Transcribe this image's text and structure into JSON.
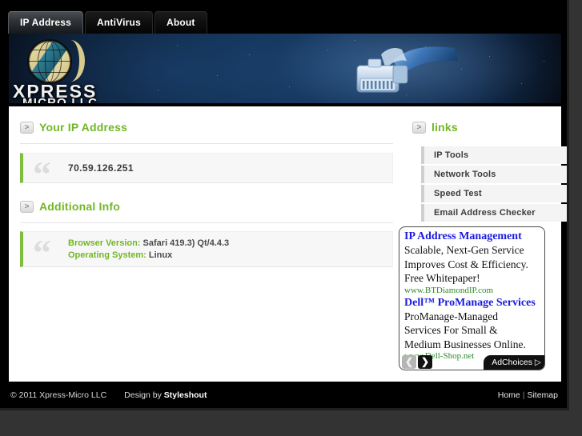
{
  "tabs": [
    {
      "label": "IP Address",
      "active": true
    },
    {
      "label": "AntiVirus",
      "active": false
    },
    {
      "label": "About",
      "active": false
    }
  ],
  "logo": {
    "line1": "XPRESS",
    "line2": "MICRO LLC",
    "globe_icon": "globe-icon",
    "banner_icon": "rj45-network-cable-icon"
  },
  "sections": {
    "ip": {
      "arrow": ">",
      "title": "Your IP Address",
      "quote_mark": "“",
      "value": "70.59.126.251"
    },
    "additional": {
      "arrow": ">",
      "title": "Additional Info",
      "quote_mark": "“",
      "browser_label": "Browser Version:",
      "browser_value": "Safari 419.3) Qt/4.4.3",
      "os_label": "Operating System:",
      "os_value": "Linux"
    }
  },
  "links": {
    "arrow": ">",
    "title": "links",
    "items": [
      {
        "label": "IP Tools"
      },
      {
        "label": "Network Tools"
      },
      {
        "label": "Speed Test"
      },
      {
        "label": "Email Address Checker"
      }
    ]
  },
  "ads": [
    {
      "title": "IP Address Management",
      "lines": [
        "Scalable, Next-Gen Service",
        "Improves Cost & Efficiency.",
        "Free Whitepaper!"
      ],
      "url": "www.BTDiamondIP.com"
    },
    {
      "title": "Dell™ ProManage Services",
      "lines": [
        "ProManage-Managed",
        "Services For Small &",
        "Medium Businesses Online."
      ],
      "url": "www.Dell-Shop.net"
    }
  ],
  "ad_controls": {
    "prev": "❮",
    "next": "❯",
    "adchoices": "AdChoices ▷"
  },
  "footer": {
    "copyright": "© 2011 Xpress-Micro LLC",
    "design_prefix": "Design by ",
    "design_by": "Styleshout",
    "home": "Home",
    "separator": "|",
    "sitemap": "Sitemap"
  },
  "colors": {
    "accent_green": "#72b626",
    "quote_border": "#7fbf3f",
    "ad_title_blue": "#1a1ae0",
    "ad_url_green": "#2e8b2e",
    "page_bg": "#333333",
    "shell_bg": "#000000"
  }
}
